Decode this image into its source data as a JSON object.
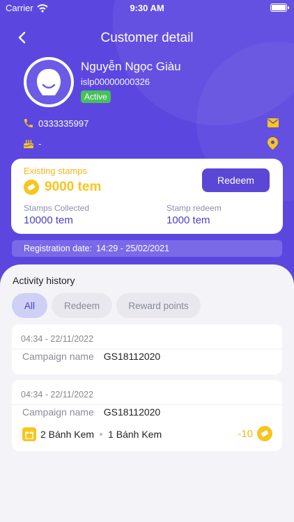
{
  "status": {
    "carrier": "Carrier",
    "time": "9:30 AM"
  },
  "header": {
    "title": "Customer detail"
  },
  "customer": {
    "name": "Nguyễn Ngọc Giàu",
    "code": "islp00000000326",
    "status": "Active",
    "phone": "0333335997",
    "birthday": "-"
  },
  "stamps": {
    "existing_label": "Existing stamps",
    "existing_value": "9000 tem",
    "redeem_label": "Redeem",
    "collected_label": "Stamps Collected",
    "collected_value": "10000 tem",
    "redeemed_label": "Stamp redeem",
    "redeemed_value": "1000 tem"
  },
  "registration": {
    "label": "Registration date:",
    "value": "14:29 - 25/02/2021"
  },
  "activity": {
    "title": "Activity history",
    "tabs": [
      "All",
      "Redeem",
      "Reward points"
    ],
    "active_tab": "All",
    "items": [
      {
        "time": "04:34 - 22/11/2022",
        "campaign_label": "Campaign name",
        "campaign_value": "GS18112020"
      },
      {
        "time": "04:34 - 22/11/2022",
        "campaign_label": "Campaign name",
        "campaign_value": "GS18112020",
        "gift_a": "2 Bánh Kem",
        "gift_b": "1 Bánh Kem",
        "points": "-10"
      }
    ]
  },
  "colors": {
    "primary": "#5b47e0",
    "accent": "#f8c51c",
    "active_green": "#47c15b"
  }
}
